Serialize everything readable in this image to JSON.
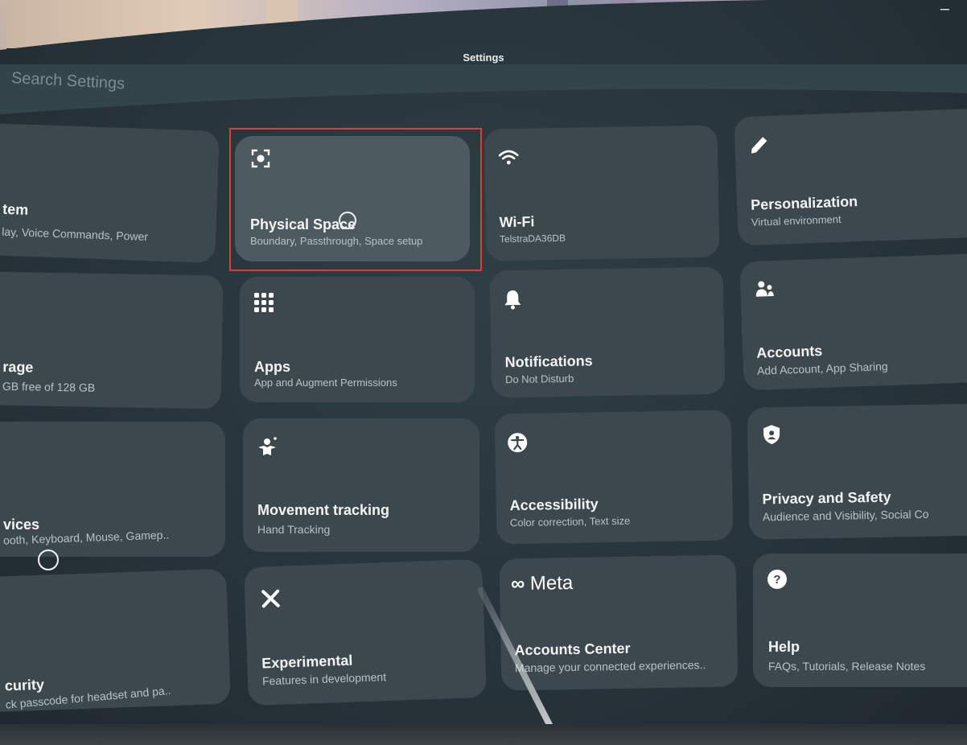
{
  "window": {
    "title": "Settings",
    "minimize_glyph": "–"
  },
  "search": {
    "placeholder": "Search Settings"
  },
  "tiles": [
    {
      "id": "system",
      "icon": "system-icon",
      "label": "tem",
      "sub": "lay, Voice Commands, Power"
    },
    {
      "id": "physical-space",
      "icon": "physical-space-icon",
      "label": "Physical Space",
      "sub": "Boundary, Passthrough, Space setup"
    },
    {
      "id": "wifi",
      "icon": "wifi-icon",
      "label": "Wi-Fi",
      "sub": "TelstraDA36DB"
    },
    {
      "id": "personalization",
      "icon": "pencil-icon",
      "label": "Personalization",
      "sub": "Virtual environment"
    },
    {
      "id": "storage",
      "icon": "storage-icon",
      "label": "rage",
      "sub": "GB free of 128 GB"
    },
    {
      "id": "apps",
      "icon": "apps-grid-icon",
      "label": "Apps",
      "sub": "App and Augment Permissions"
    },
    {
      "id": "notifications",
      "icon": "bell-icon",
      "label": "Notifications",
      "sub": "Do Not Disturb"
    },
    {
      "id": "accounts",
      "icon": "people-icon",
      "label": "Accounts",
      "sub": "Add Account, App Sharing"
    },
    {
      "id": "devices",
      "icon": "devices-icon",
      "label": "vices",
      "sub": "ooth, Keyboard, Mouse, Gamep.."
    },
    {
      "id": "movement-tracking",
      "icon": "movement-icon",
      "label": "Movement tracking",
      "sub": "Hand Tracking"
    },
    {
      "id": "accessibility",
      "icon": "accessibility-icon",
      "label": "Accessibility",
      "sub": "Color correction, Text size"
    },
    {
      "id": "privacy",
      "icon": "shield-icon",
      "label": "Privacy and Safety",
      "sub": "Audience and Visibility, Social Co"
    },
    {
      "id": "security",
      "icon": "lock-icon",
      "label": "curity",
      "sub": "ck passcode for headset and pa.."
    },
    {
      "id": "experimental",
      "icon": "experimental-icon",
      "label": "Experimental",
      "sub": "Features in development"
    },
    {
      "id": "accounts-center",
      "icon": "meta-logo-icon",
      "label": "Accounts Center",
      "sub": "Manage your connected experiences.."
    },
    {
      "id": "help",
      "icon": "help-icon",
      "label": "Help",
      "sub": "FAQs, Tutorials, Release Notes"
    }
  ],
  "meta_logo_text": "Meta",
  "colors": {
    "highlight": "#e23b3b",
    "panel": "#27333a",
    "tile": "#3c484e",
    "tile_active": "#4d5b61"
  }
}
